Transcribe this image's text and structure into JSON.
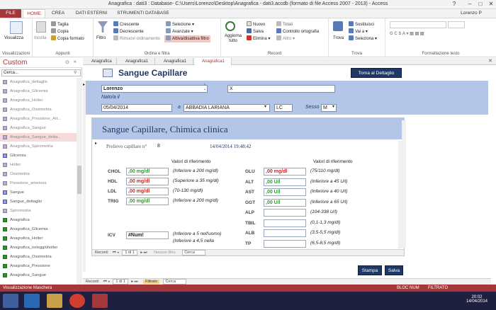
{
  "window": {
    "title": "Anagrafica : dati3 : Database- C:\\Users\\Lorenzo\\Desktop\\Anagrafica - dati3.accdb (formato di file Access 2007 - 2013) - Access",
    "user": "Lorenzo P"
  },
  "ribbon_tabs": [
    "FILE",
    "HOME",
    "CREA",
    "DATI ESTERNI",
    "STRUMENTI DATABASE"
  ],
  "ribbon": {
    "visualizza": "Visualizza",
    "incolla": "Incolla",
    "taglia": "Taglia",
    "copia": "Copia",
    "copia_formato": "Copia formato",
    "filtro": "Filtro",
    "crescente": "Crescente",
    "decrescente": "Decrescente",
    "rimuovi_ord": "Rimuovi ordinamento",
    "selezione": "Selezione",
    "avanzate": "Avanzate",
    "attiva_filtro": "Attiva/disattiva filtro",
    "aggiorna": "Aggiorna tutto",
    "nuovo": "Nuovo",
    "salva": "Salva",
    "elimina": "Elimina",
    "totali": "Totali",
    "controllo": "Controllo ortografia",
    "altro": "Altro",
    "trova": "Trova",
    "sostituisci": "Sostituisci",
    "vai_a": "Vai a",
    "seleziona": "Seleziona",
    "groups": [
      "Visualizzazioni",
      "Appunti",
      "Ordina e filtra",
      "Record",
      "Trova",
      "Formattazione testo"
    ]
  },
  "nav": {
    "title": "Custom",
    "search": "Cerca...",
    "items": [
      {
        "label": "Anagrafica_dettaglio",
        "kind": "q"
      },
      {
        "label": "Anagrafica_Glicemia",
        "kind": "q"
      },
      {
        "label": "Anagrafica_Holter",
        "kind": "q"
      },
      {
        "label": "Anagrafica_Ossimetria",
        "kind": "q"
      },
      {
        "label": "Anagrafica_Pressione_Art...",
        "kind": "q"
      },
      {
        "label": "Anagrafica_Sangue",
        "kind": "q"
      },
      {
        "label": "Anagrafica_Sangue_detta...",
        "kind": "sel"
      },
      {
        "label": "Anagrafica_Spirometria",
        "kind": "q"
      },
      {
        "label": "Glicemia",
        "kind": "fm"
      },
      {
        "label": "Holter",
        "kind": "q"
      },
      {
        "label": "Ossimetria",
        "kind": "q"
      },
      {
        "label": "Pressione_arteriosa",
        "kind": "q"
      },
      {
        "label": "Sangue",
        "kind": "fm"
      },
      {
        "label": "Sangue_dettaglio",
        "kind": "fm"
      },
      {
        "label": "Spirometria",
        "kind": "q"
      },
      {
        "label": "Anagrafica",
        "kind": "tb"
      },
      {
        "label": "Anagrafica_Glicemia",
        "kind": "tb"
      },
      {
        "label": "Anagrafica_Holter",
        "kind": "tb"
      },
      {
        "label": "Anagrafica_noleggioholter",
        "kind": "tb"
      },
      {
        "label": "Anagrafica_Ossimetria",
        "kind": "tb"
      },
      {
        "label": "Anagrafica_Pressione",
        "kind": "tb"
      },
      {
        "label": "Anagrafica_Sangue",
        "kind": "tb"
      }
    ]
  },
  "doc_tabs": [
    "Anagrafica",
    "Anagrafica1",
    "Anagrafica1",
    "Anagrafica1"
  ],
  "form": {
    "title": "Sangue Capillare",
    "back": "Torna al Dettaglio",
    "nome": "Lorenzo",
    "cognome": "X",
    "nato_label": "Nato/a il",
    "data_nascita": "05/04/2014",
    "a_label": "a",
    "luogo": "ABBADIA LARIANA",
    "prov": "LC",
    "sesso_label": "Sesso",
    "sesso": "M",
    "sub_title": "Sangue Capillare, Chimica clinica",
    "prelievo_label": "Prelievo capillare n°",
    "prelievo_n": "8",
    "prelievo_data": "14/04/2014 19:48:42",
    "ref_header": "Valori di riferimento",
    "left": [
      {
        "name": "CHOL",
        "value": ",00 mg/dl",
        "color": "g",
        "ref": "(Inferiore a 200 mg/dl)"
      },
      {
        "name": "HDL",
        "value": ",00 mg/dl",
        "color": "r",
        "ref": "(Superiore a 35 mg/dl)"
      },
      {
        "name": "LDL",
        "value": ",00 mg/dl",
        "color": "r",
        "ref": "(70-130 mg/dl)"
      },
      {
        "name": "TRIG",
        "value": ",00 mg/dl",
        "color": "g",
        "ref": "(Inferiore a 200 mg/dl)"
      }
    ],
    "right": [
      {
        "name": "GLU",
        "value": ",00 mg/dl",
        "color": "r",
        "ref": "(75/110 mg/dl)"
      },
      {
        "name": "ALT",
        "value": ",00 U/l",
        "color": "g",
        "ref": "(Inferiore a 45 U/l)"
      },
      {
        "name": "AST",
        "value": ",00 U/l",
        "color": "g",
        "ref": "(Inferiore a 40 U/l)"
      },
      {
        "name": "GGT",
        "value": ",00 U/l",
        "color": "g",
        "ref": "(Inferiore a 65 U/l)"
      },
      {
        "name": "ALP",
        "value": "",
        "color": "g",
        "ref": "(104-338 U/l)"
      },
      {
        "name": "TBIL",
        "value": "",
        "color": "g",
        "ref": "(0,1-1,3 mg/dl)"
      },
      {
        "name": "ALB",
        "value": "",
        "color": "g",
        "ref": "(3,5-5,5 mg/dl)"
      },
      {
        "name": "TP",
        "value": "",
        "color": "g",
        "ref": "(6,5-8,5 mg/dl)"
      }
    ],
    "icv_label": "ICV",
    "icv_value": "#Num!",
    "icv_ref1": "(Inferiore a 5 nell'uomo)",
    "icv_ref2": "(Inferiore a 4,5 nella",
    "sub_nav": {
      "record": "Record:",
      "pos": "1 di 1",
      "nofilter": "Nessun filtro",
      "search": "Cerca"
    },
    "stampa": "Stampa",
    "salva": "Salva"
  },
  "main_nav": {
    "record": "Record:",
    "pos": "1 di 1",
    "filter": "Filtrato",
    "search": "Cerca"
  },
  "status": {
    "left": "Visualizzazione Maschera",
    "num": "BLOC NUM",
    "filtrato": "FILTRATO"
  },
  "taskbar": {
    "time": "20:02",
    "date": "14/04/2014"
  }
}
